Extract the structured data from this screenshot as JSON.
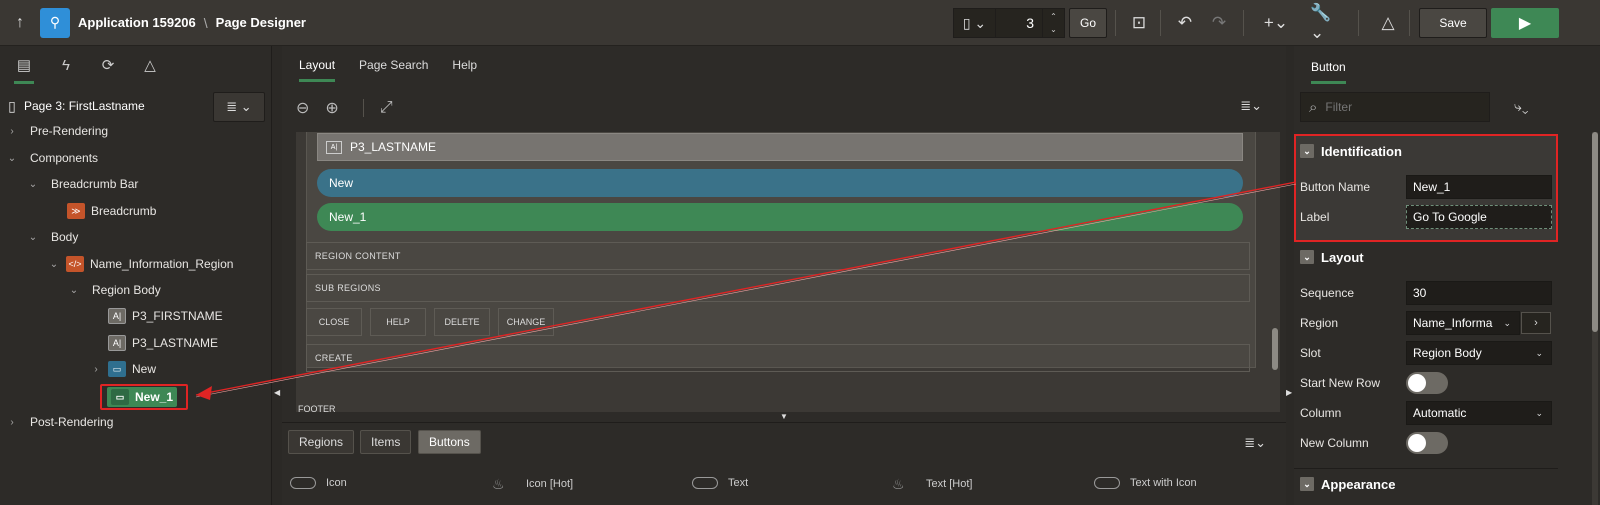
{
  "header": {
    "app_title": "Application 159206",
    "separator": "\\",
    "page_title": "Page Designer",
    "page_number": "3",
    "go_label": "Go",
    "save_label": "Save"
  },
  "left_panel": {
    "page_label": "Page 3: FirstLastname",
    "tree": [
      {
        "label": "Pre-Rendering"
      },
      {
        "label": "Components"
      },
      {
        "label": "Breadcrumb Bar"
      },
      {
        "label": "Breadcrumb"
      },
      {
        "label": "Body"
      },
      {
        "label": "Name_Information_Region"
      },
      {
        "label": "Region Body"
      },
      {
        "label": "P3_FIRSTNAME"
      },
      {
        "label": "P3_LASTNAME"
      },
      {
        "label": "New"
      },
      {
        "label": "New_1"
      },
      {
        "label": "Post-Rendering"
      }
    ]
  },
  "center_panel": {
    "tabs": [
      "Layout",
      "Page Search",
      "Help"
    ],
    "canvas": {
      "item": "P3_LASTNAME",
      "button_new": "New",
      "button_new1": "New_1",
      "region_content": "REGION CONTENT",
      "sub_regions": "SUB REGIONS",
      "slots": [
        "CLOSE",
        "HELP",
        "DELETE",
        "CHANGE"
      ],
      "create": "CREATE",
      "footer": "FOOTER"
    },
    "gallery_tabs": [
      "Regions",
      "Items",
      "Buttons"
    ],
    "gallery_items": [
      "Icon",
      "Icon [Hot]",
      "Text",
      "Text [Hot]",
      "Text with Icon"
    ]
  },
  "right_panel": {
    "tab": "Button",
    "filter_placeholder": "Filter",
    "sections": {
      "identification": "Identification",
      "layout": "Layout",
      "appearance": "Appearance"
    },
    "props": {
      "button_name_label": "Button Name",
      "button_name": "New_1",
      "label_label": "Label",
      "label_value": "Go To Google",
      "sequence_label": "Sequence",
      "sequence": "30",
      "region_label": "Region",
      "region": "Name_Informa",
      "slot_label": "Slot",
      "slot": "Region Body",
      "start_new_row_label": "Start New Row",
      "column_label": "Column",
      "column": "Automatic",
      "new_column_label": "New Column"
    }
  },
  "colors": {
    "accent_green": "#3e8855",
    "annotation_red": "#e02424",
    "app_blue": "#2f8fd8"
  }
}
